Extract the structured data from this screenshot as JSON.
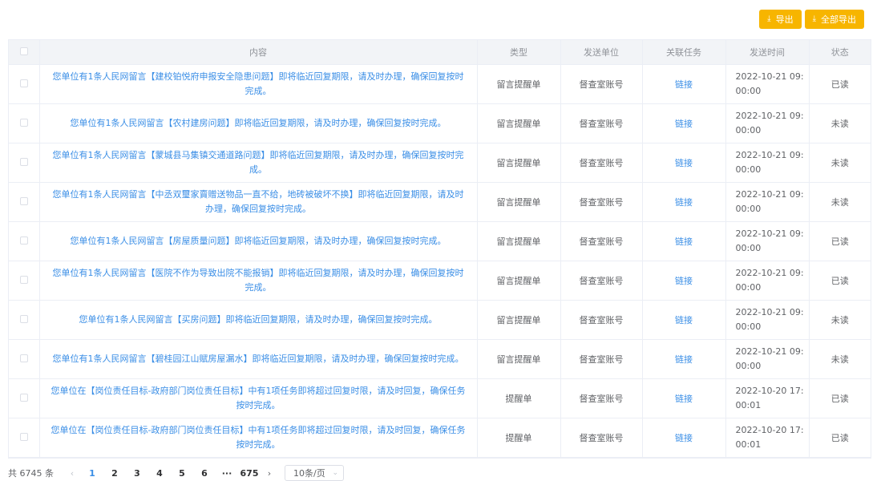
{
  "toolbar": {
    "export_label": "导出",
    "export_all_label": "全部导出",
    "export_icon": "download-icon",
    "accent_color": "#f7b500"
  },
  "table": {
    "headers": {
      "content": "内容",
      "type": "类型",
      "unit": "发送单位",
      "task": "关联任务",
      "time": "发送时间",
      "status": "状态"
    },
    "rows": [
      {
        "content": "您单位有1条人民网留言【建校铂悦府申报安全隐患问题】即将临近回复期限，请及时办理，确保回复按时完成。",
        "type": "留言提醒单",
        "unit": "督查室账号",
        "task": "链接",
        "time": "2022-10-21 09:00:00",
        "status": "已读"
      },
      {
        "content": "您单位有1条人民网留言【农村建房问题】即将临近回复期限，请及时办理，确保回复按时完成。",
        "type": "留言提醒单",
        "unit": "督查室账号",
        "task": "链接",
        "time": "2022-10-21 09:00:00",
        "status": "未读"
      },
      {
        "content": "您单位有1条人民网留言【蒙城县马集镇交通道路问题】即将临近回复期限，请及时办理，确保回复按时完成。",
        "type": "留言提醒单",
        "unit": "督查室账号",
        "task": "链接",
        "time": "2022-10-21 09:00:00",
        "status": "未读"
      },
      {
        "content": "您单位有1条人民网留言【中丞双璽家賣贈送物品一直不给，地砖被破坏不换】即将临近回复期限，请及时办理，确保回复按时完成。",
        "type": "留言提醒单",
        "unit": "督查室账号",
        "task": "链接",
        "time": "2022-10-21 09:00:00",
        "status": "未读"
      },
      {
        "content": "您单位有1条人民网留言【房屋质量问题】即将临近回复期限，请及时办理，确保回复按时完成。",
        "type": "留言提醒单",
        "unit": "督查室账号",
        "task": "链接",
        "time": "2022-10-21 09:00:00",
        "status": "已读"
      },
      {
        "content": "您单位有1条人民网留言【医院不作为导致出院不能报销】即将临近回复期限，请及时办理，确保回复按时完成。",
        "type": "留言提醒单",
        "unit": "督查室账号",
        "task": "链接",
        "time": "2022-10-21 09:00:00",
        "status": "已读"
      },
      {
        "content": "您单位有1条人民网留言【买房问题】即将临近回复期限，请及时办理，确保回复按时完成。",
        "type": "留言提醒单",
        "unit": "督查室账号",
        "task": "链接",
        "time": "2022-10-21 09:00:00",
        "status": "未读"
      },
      {
        "content": "您单位有1条人民网留言【碧桂园江山赋房屋漏水】即将临近回复期限，请及时办理，确保回复按时完成。",
        "type": "留言提醒单",
        "unit": "督查室账号",
        "task": "链接",
        "time": "2022-10-21 09:00:00",
        "status": "未读"
      },
      {
        "content": "您单位在【岗位责任目标-政府部门岗位责任目标】中有1项任务即将超过回复时限，请及时回复，确保任务按时完成。",
        "type": "提醒单",
        "unit": "督查室账号",
        "task": "链接",
        "time": "2022-10-20 17:00:01",
        "status": "已读"
      },
      {
        "content": "您单位在【岗位责任目标-政府部门岗位责任目标】中有1项任务即将超过回复时限，请及时回复，确保任务按时完成。",
        "type": "提醒单",
        "unit": "督查室账号",
        "task": "链接",
        "time": "2022-10-20 17:00:01",
        "status": "已读"
      }
    ]
  },
  "pagination": {
    "total_text": "共 6745 条",
    "prev_icon": "chevron-left-icon",
    "next_icon": "chevron-right-icon",
    "pages": [
      "1",
      "2",
      "3",
      "4",
      "5",
      "6",
      "···",
      "675"
    ],
    "current": "1",
    "page_size": "10条/页",
    "size_icon": "chevron-down-icon"
  }
}
